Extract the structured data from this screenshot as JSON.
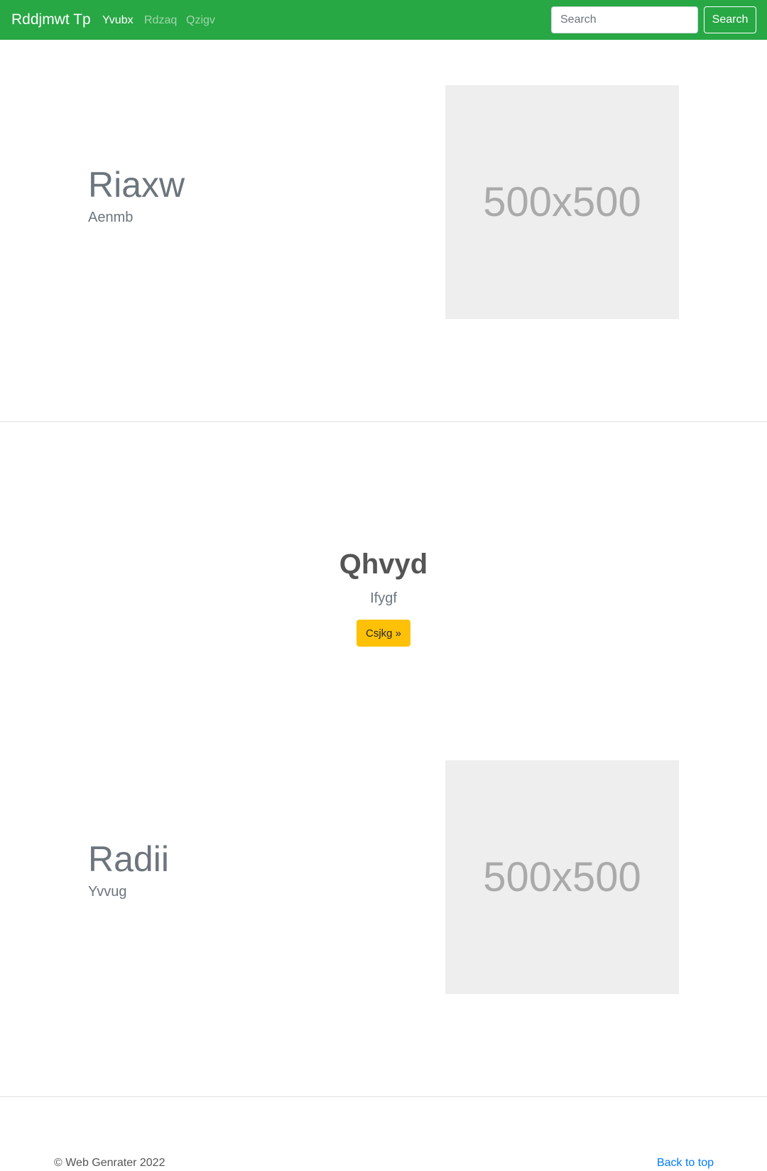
{
  "navbar": {
    "brand": "Rddjmwt Tp",
    "links": [
      {
        "label": "Yvubx",
        "active": true
      },
      {
        "label": "Rdzaq",
        "active": false
      },
      {
        "label": "Qzigv",
        "active": false
      }
    ],
    "search_placeholder": "Search",
    "search_button_label": "Search",
    "background_color": "#28a745"
  },
  "features": [
    {
      "title": "Riaxw",
      "subtitle": "Aenmb",
      "image_label": "500x500"
    },
    {
      "title": "Radii",
      "subtitle": "Yvvug",
      "image_label": "500x500"
    }
  ],
  "center": {
    "title": "Qhvyd",
    "subtitle": "Ifygf",
    "button_label": "Csjkg »",
    "button_color": "#ffc107"
  },
  "footer": {
    "copyright": "© Web Genrater 2022",
    "back_to_top": "Back to top"
  }
}
